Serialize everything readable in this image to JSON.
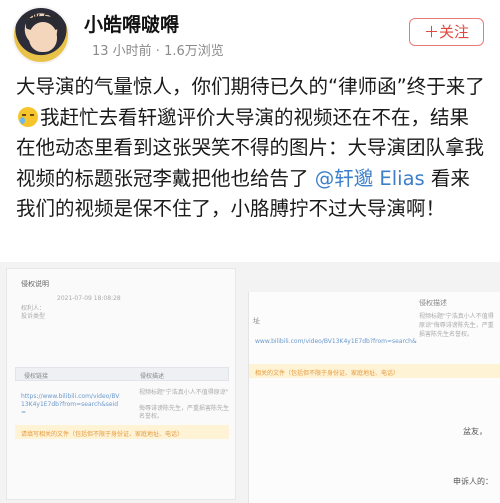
{
  "user": {
    "avatar_badge": "NEW STAR",
    "name": "小皓嘚啵嘚",
    "meta": "13 小时前 · 1.6万浏览",
    "follow_label": "＋关注"
  },
  "post": {
    "text_1": "大导演的气量惊人，你们期待已久的“律师函”终于来了",
    "emoji": "crying-laughing-emoji",
    "text_2": "我赶忙去看轩邈评价大导演的视频还在不在，结果在他动态里看到这张哭笑不得的图片：大导演团队拿我视频的标题张冠李戴把他也给告了",
    "mention": "@轩邈 Elias",
    "text_3": " 看来我们的视频是保不住了，小胳膊拧不过大导演啊！"
  },
  "screenshot": {
    "left": {
      "section_title": "侵权说明",
      "date_label": "2021-07-09 18:08:28",
      "label_rights": "权利人：",
      "label_claim": "投诉类型",
      "th_link": "侵权链接",
      "th_desc": "侵权描述",
      "url": "https://www.bilibili.com/video/BV13K4y1E7db?from=search&seid=",
      "desc": "视频标题\"宁浩真小人不值得原谅\"",
      "desc2": "侮辱诽谤陈先生，严重损害陈先生名誉权。",
      "warning": "请填写相关的文件（包括但不限于身份证、家庭地址、电话）"
    },
    "right": {
      "th_desc": "侵权描述",
      "prefix": "址",
      "url": "www.bilibili.com/video/BV13K4y1E7db?from=search&",
      "desc": "视频标题\"宁浩真小人不值得原谅\"侮辱诽谤陈先生，严重损害陈先生名誉权。",
      "warning": "相关的文件（包括但不限于身份证、家庭地址、电话）",
      "reply_1": "盆友，",
      "reply_2": "申诉人的："
    }
  },
  "colors": {
    "accent_red": "#e0483f",
    "mention_blue": "#3d7fc8"
  }
}
